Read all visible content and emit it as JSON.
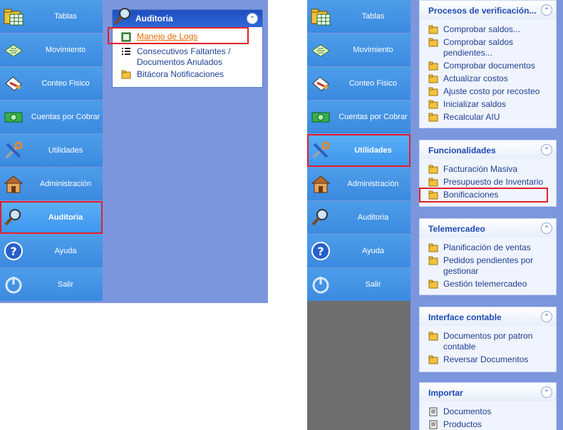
{
  "left": {
    "nav": [
      {
        "label": "Tablas",
        "icon": "folder-table-icon"
      },
      {
        "label": "Movimiento",
        "icon": "document-move-icon"
      },
      {
        "label": "Conteo Fisico",
        "icon": "clipboard-pen-icon"
      },
      {
        "label": "Cuentas por Cobrar",
        "icon": "money-icon"
      },
      {
        "label": "Utilidades",
        "icon": "tools-icon"
      },
      {
        "label": "Administración",
        "icon": "house-icon"
      },
      {
        "label": "Auditoria",
        "icon": "magnifier-icon"
      },
      {
        "label": "Ayuda",
        "icon": "help-icon"
      },
      {
        "label": "Salir",
        "icon": "power-icon"
      }
    ],
    "popup": {
      "title": "Auditoria",
      "items": [
        {
          "label": "Manejo de Logs",
          "icon": "log-book-icon"
        },
        {
          "label": "Consecutivos Faltantes / Documentos Anulados",
          "icon": "list-icon"
        },
        {
          "label": "Bitácora Notificaciones",
          "icon": "folder-icon"
        }
      ]
    }
  },
  "right": {
    "nav": [
      {
        "label": "Tablas"
      },
      {
        "label": "Movimiento"
      },
      {
        "label": "Conteo Fisico"
      },
      {
        "label": "Cuentas por Cobrar"
      },
      {
        "label": "Utilidades"
      },
      {
        "label": "Administración"
      },
      {
        "label": "Auditoria"
      },
      {
        "label": "Ayuda"
      },
      {
        "label": "Salir"
      }
    ],
    "sections": [
      {
        "title": "Procesos de verificación...",
        "items": [
          "Comprobar saldos...",
          "Comprobar saldos pendientes...",
          "Comprobar documentos",
          "Actualizar costos",
          "Ajuste costo por recosteo",
          "Inicializar saldos",
          "Recalcular AIU"
        ]
      },
      {
        "title": "Funcionalidades",
        "items": [
          "Facturación Masiva",
          "Presupuesto de Inventario",
          "Bonificaciones"
        ]
      },
      {
        "title": "Telemercadeo",
        "items": [
          "Planificación de ventas",
          "Pedidos pendientes por gestionar",
          "Gestión telemercadeo"
        ]
      },
      {
        "title": "Interface contable",
        "items": [
          "Documentos por patron contable",
          "Reversar Documentos"
        ]
      },
      {
        "title": "Importar",
        "items": [
          "Documentos",
          "Productos"
        ]
      }
    ]
  },
  "colors": {
    "nav_blue": "#3b8ae0",
    "panel_bg": "#7b96dd",
    "popup_header": "#1f4ec0",
    "highlight_red": "#e0202a",
    "link_orange": "#e06a00"
  }
}
